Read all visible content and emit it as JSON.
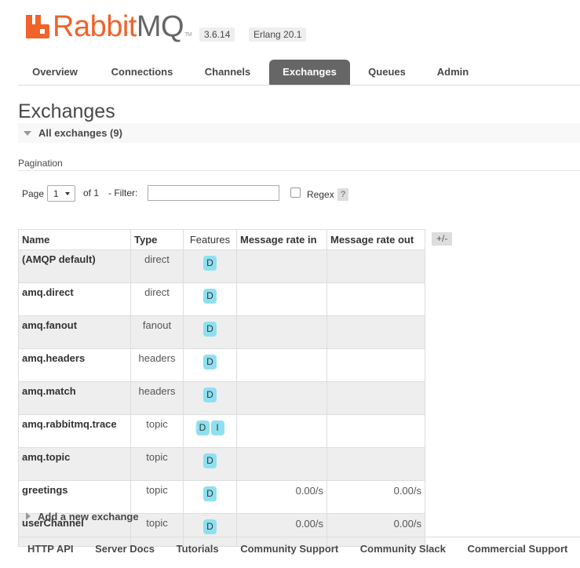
{
  "brand": {
    "name_part1": "Rabbit",
    "name_part2": "MQ",
    "tm": "TM",
    "accent": "#f0632a"
  },
  "versions": {
    "rabbitmq": "3.6.14",
    "erlang": "Erlang 20.1"
  },
  "nav": {
    "tabs": [
      {
        "label": "Overview",
        "active": false
      },
      {
        "label": "Connections",
        "active": false
      },
      {
        "label": "Channels",
        "active": false
      },
      {
        "label": "Exchanges",
        "active": true
      },
      {
        "label": "Queues",
        "active": false
      },
      {
        "label": "Admin",
        "active": false
      }
    ]
  },
  "page": {
    "title": "Exchanges",
    "section_label": "All exchanges (9)"
  },
  "pagination": {
    "heading": "Pagination",
    "page_label": "Page",
    "page_value": "1",
    "of_label": "of 1",
    "filter_label": "- Filter:",
    "filter_value": "",
    "regex_label": "Regex",
    "regex_checked": false,
    "help_label": "?"
  },
  "table": {
    "headers": {
      "name": "Name",
      "type": "Type",
      "features": "Features",
      "rate_in": "Message rate in",
      "rate_out": "Message rate out"
    },
    "toggle_columns_label": "+/-",
    "rows": [
      {
        "name": "(AMQP default)",
        "type": "direct",
        "features": [
          "D"
        ],
        "rate_in": "",
        "rate_out": ""
      },
      {
        "name": "amq.direct",
        "type": "direct",
        "features": [
          "D"
        ],
        "rate_in": "",
        "rate_out": ""
      },
      {
        "name": "amq.fanout",
        "type": "fanout",
        "features": [
          "D"
        ],
        "rate_in": "",
        "rate_out": ""
      },
      {
        "name": "amq.headers",
        "type": "headers",
        "features": [
          "D"
        ],
        "rate_in": "",
        "rate_out": ""
      },
      {
        "name": "amq.match",
        "type": "headers",
        "features": [
          "D"
        ],
        "rate_in": "",
        "rate_out": ""
      },
      {
        "name": "amq.rabbitmq.trace",
        "type": "topic",
        "features": [
          "D",
          "I"
        ],
        "rate_in": "",
        "rate_out": ""
      },
      {
        "name": "amq.topic",
        "type": "topic",
        "features": [
          "D"
        ],
        "rate_in": "",
        "rate_out": ""
      },
      {
        "name": "greetings",
        "type": "topic",
        "features": [
          "D"
        ],
        "rate_in": "0.00/s",
        "rate_out": "0.00/s"
      },
      {
        "name": "userChannel",
        "type": "topic",
        "features": [
          "D"
        ],
        "rate_in": "0.00/s",
        "rate_out": "0.00/s"
      }
    ]
  },
  "add_exchange_label": "Add a new exchange",
  "footer": {
    "links": [
      "HTTP API",
      "Server Docs",
      "Tutorials",
      "Community Support",
      "Community Slack",
      "Commercial Support"
    ]
  }
}
